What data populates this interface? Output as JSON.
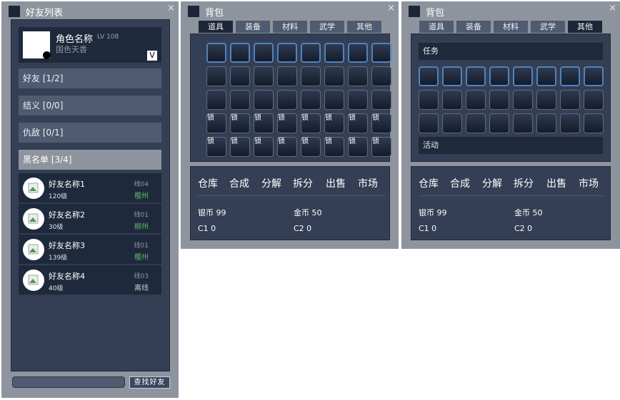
{
  "friend_window": {
    "title": "好友列表",
    "close": "×",
    "profile": {
      "name": "角色名称",
      "level": "LV 108",
      "subtitle": "国色天香",
      "badge": "V"
    },
    "categories": [
      {
        "label": "好友 [1/2]"
      },
      {
        "label": "结义 [0/0]"
      },
      {
        "label": "仇敌 [0/1]"
      },
      {
        "label": "黑名单 [3/4]"
      }
    ],
    "friends": [
      {
        "name": "好友名称1",
        "level": "120级",
        "line": "线04",
        "location": "樱州",
        "location_color": "#5fb86a"
      },
      {
        "name": "好友名称2",
        "level": "30级",
        "line": "线01",
        "location": "柳州",
        "location_color": "#5fb86a"
      },
      {
        "name": "好友名称3",
        "level": "139级",
        "line": "线01",
        "location": "樱州",
        "location_color": "#5fb86a"
      },
      {
        "name": "好友名称4",
        "level": "40级",
        "line": "线03",
        "location": "离线",
        "location_color": "#c6cad2"
      }
    ],
    "search_button": "查找好友"
  },
  "bag1": {
    "title": "背包",
    "close": "×",
    "tabs": [
      "道具",
      "装备",
      "材料",
      "武学",
      "其他"
    ],
    "active_tab": 0,
    "locked_label": "锁",
    "actions": [
      "仓库",
      "合成",
      "分解",
      "拆分",
      "出售",
      "市场"
    ],
    "currency": {
      "silver": "银币 99",
      "gold": "金币 50",
      "c1": "C1 0",
      "c2": "C2 0"
    }
  },
  "bag2": {
    "title": "背包",
    "close": "×",
    "tabs": [
      "道具",
      "装备",
      "材料",
      "武学",
      "其他"
    ],
    "active_tab": 4,
    "section_task": "任务",
    "section_event": "活动",
    "actions": [
      "仓库",
      "合成",
      "分解",
      "拆分",
      "出售",
      "市场"
    ],
    "currency": {
      "silver": "银币 99",
      "gold": "金币 50",
      "c1": "C1 0",
      "c2": "C2 0"
    }
  },
  "colors": {
    "frame": "#8e949e",
    "panel": "#343e54",
    "dark": "#1e2a3c",
    "slot_highlight": "#4d84c0"
  }
}
